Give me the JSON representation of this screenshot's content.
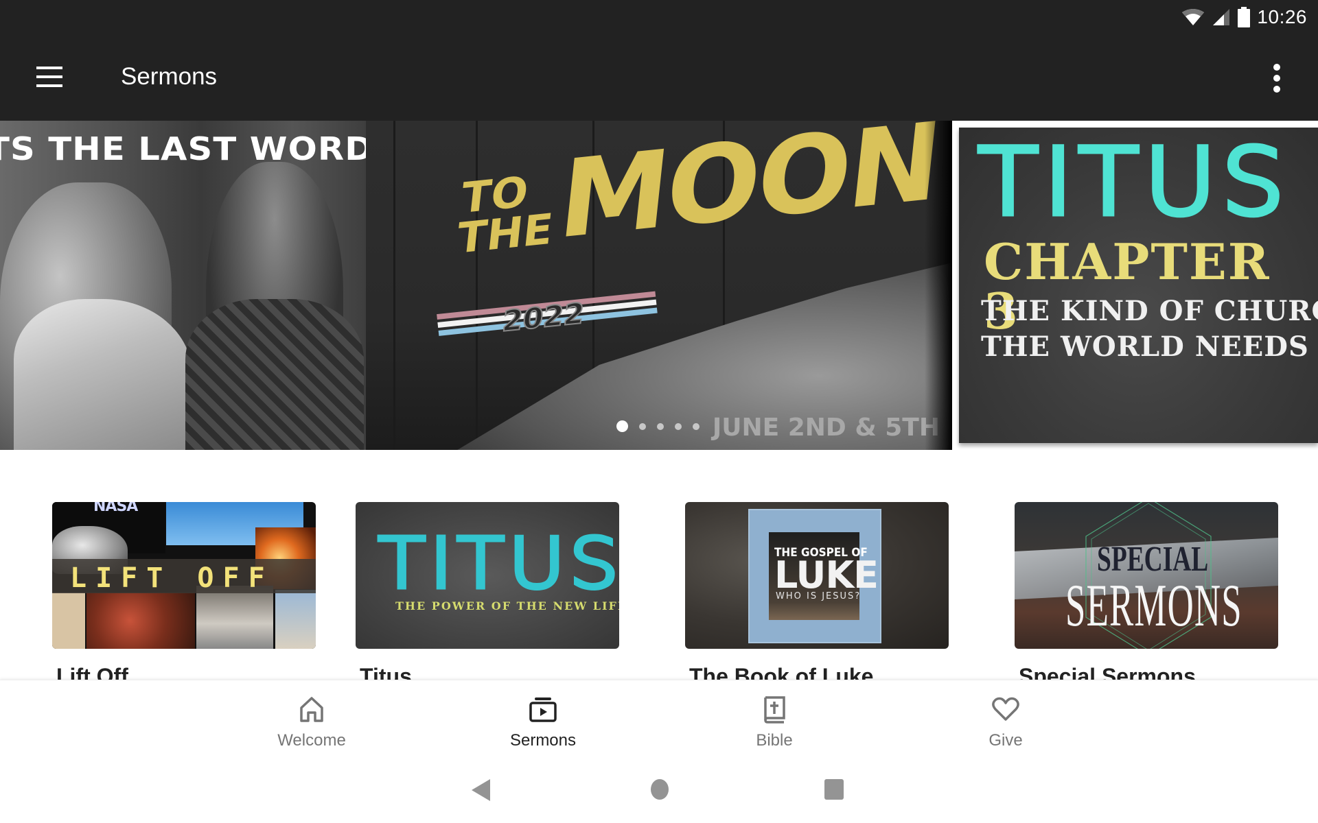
{
  "status_bar": {
    "time": "10:26",
    "icons": [
      "wifi-icon",
      "signal-icon",
      "battery-icon"
    ]
  },
  "app_bar": {
    "menu_icon": "hamburger-menu-icon",
    "title": "Sermons",
    "overflow_icon": "more-vert-icon"
  },
  "carousel": {
    "slides": [
      {
        "title": "TS THE LAST WORD"
      },
      {
        "title_small_1": "TO",
        "title_small_2": "THE",
        "title_big": "MOON",
        "year": "2022",
        "date": "JUNE 2ND & 5TH"
      },
      {
        "title": "TITUS",
        "subtitle": "CHAPTER 3",
        "line1": "THE KIND OF CHURCH",
        "line2": "THE WORLD NEEDS"
      }
    ],
    "slide_count": 5,
    "active_index": 0
  },
  "series": [
    {
      "title": "Lift Off",
      "art_text": "LIFT OFF",
      "art_logo": "NASA"
    },
    {
      "title": "Titus",
      "art_text": "TITUS",
      "art_subtitle": "THE POWER OF THE NEW LIFE"
    },
    {
      "title": "The Book of Luke",
      "art_line1": "THE GOSPEL OF",
      "art_line2": "LUKE",
      "art_line3": "WHO IS JESUS?"
    },
    {
      "title": "Special Sermons",
      "art_line1": "SPECIAL",
      "art_line2": "SERMONS"
    }
  ],
  "bottom_nav": {
    "items": [
      {
        "label": "Welcome",
        "icon": "home-icon",
        "active": false
      },
      {
        "label": "Sermons",
        "icon": "video-library-icon",
        "active": true
      },
      {
        "label": "Bible",
        "icon": "bible-icon",
        "active": false
      },
      {
        "label": "Give",
        "icon": "heart-icon",
        "active": false
      }
    ]
  },
  "system_nav": {
    "back": "back-icon",
    "home": "home-circle-icon",
    "recents": "recents-icon"
  },
  "colors": {
    "app_bar": "#222222",
    "active_nav": "#222222",
    "inactive_nav": "#757575",
    "titus_cyan": "#33c6d0"
  }
}
